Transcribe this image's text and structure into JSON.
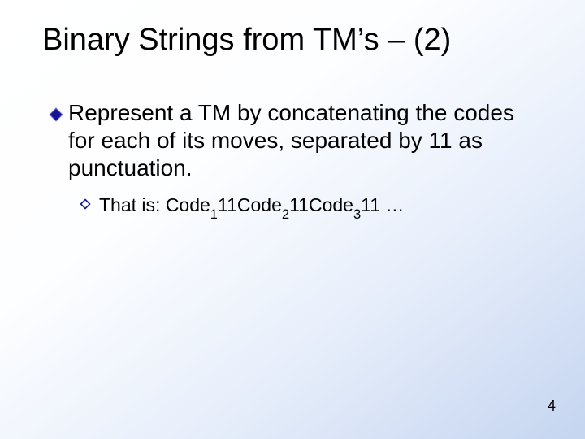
{
  "title": "Binary Strings from TM’s – (2)",
  "bullet1_text": "Represent a TM by concatenating the codes for each of its moves, separated by 11 as punctuation.",
  "bullet2": {
    "prefix": "That is: ",
    "code_label": "Code",
    "sep": "11",
    "subs": [
      "1",
      "2",
      "3"
    ],
    "trail": " …"
  },
  "page_number": "4",
  "colors": {
    "diamond_fill": "#161694",
    "diamond_stroke": "#8a8ae0",
    "small_diamond_fill": "#ffffff",
    "small_diamond_stroke": "#161694"
  }
}
